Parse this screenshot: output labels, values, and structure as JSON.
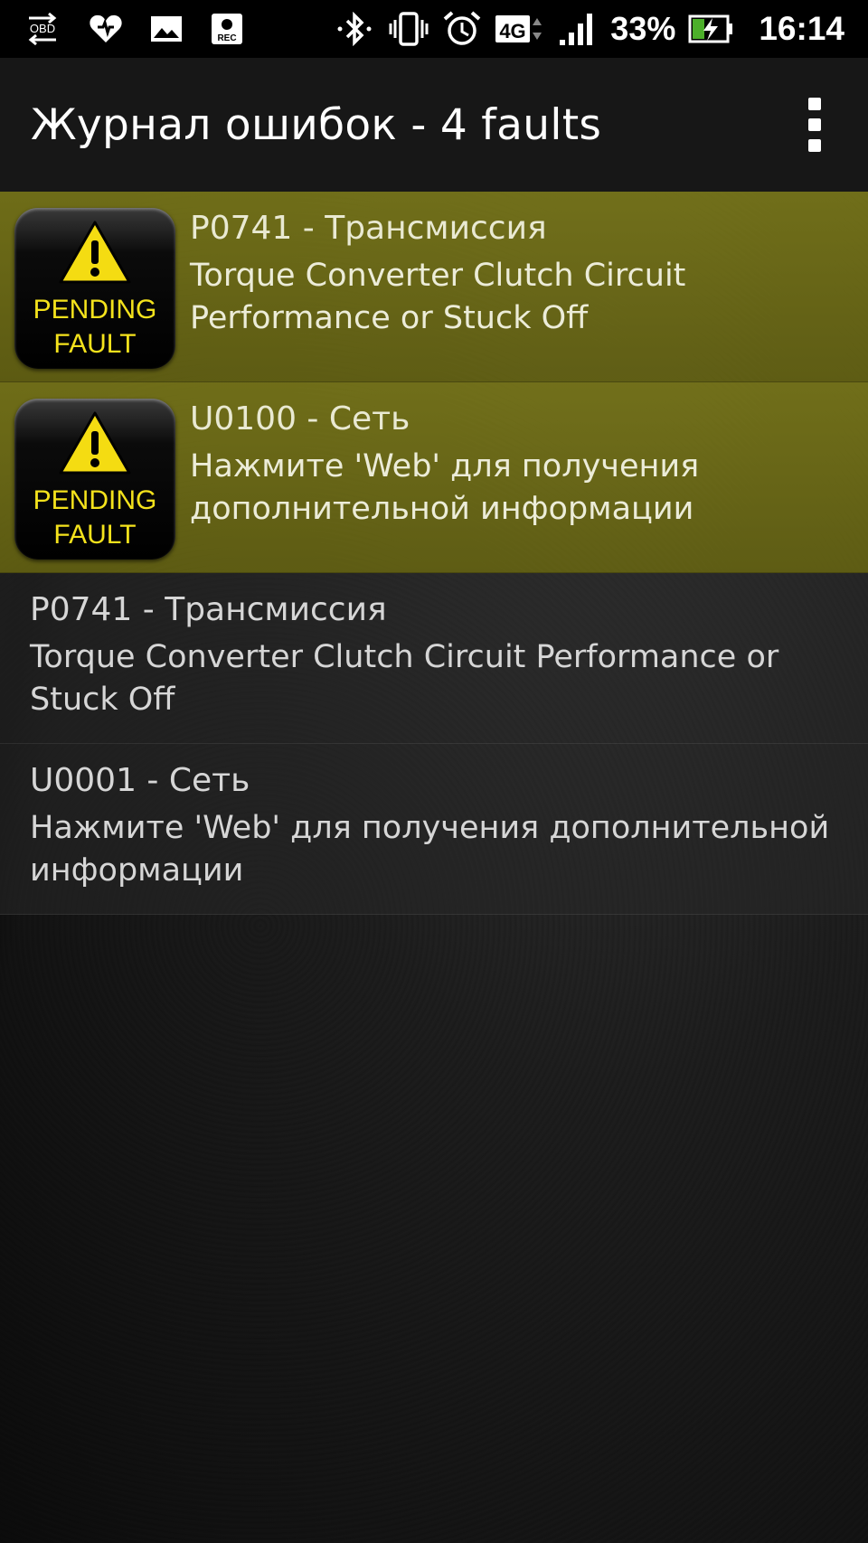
{
  "status_bar": {
    "obd_icon_label": "OBD",
    "rec_icon_label": "REC",
    "network": "4G",
    "battery": "33%",
    "time": "16:14"
  },
  "toolbar": {
    "title": "Журнал ошибок - 4 faults"
  },
  "faults": [
    {
      "code": "P0741 - Трансмиссия",
      "description": "Torque Converter Clutch Circuit Performance or Stuck Off",
      "badge_line1": "PENDING",
      "badge_line2": "FAULT"
    },
    {
      "code": "U0100 - Сеть",
      "description": "Нажмите 'Web' для получения дополнительной информации",
      "badge_line1": "PENDING",
      "badge_line2": "FAULT"
    },
    {
      "code": "P0741 - Трансмиссия",
      "description": "Torque Converter Clutch Circuit Performance or Stuck Off"
    },
    {
      "code": "U0001 - Сеть",
      "description": "Нажмите 'Web' для получения дополнительной информации"
    }
  ]
}
